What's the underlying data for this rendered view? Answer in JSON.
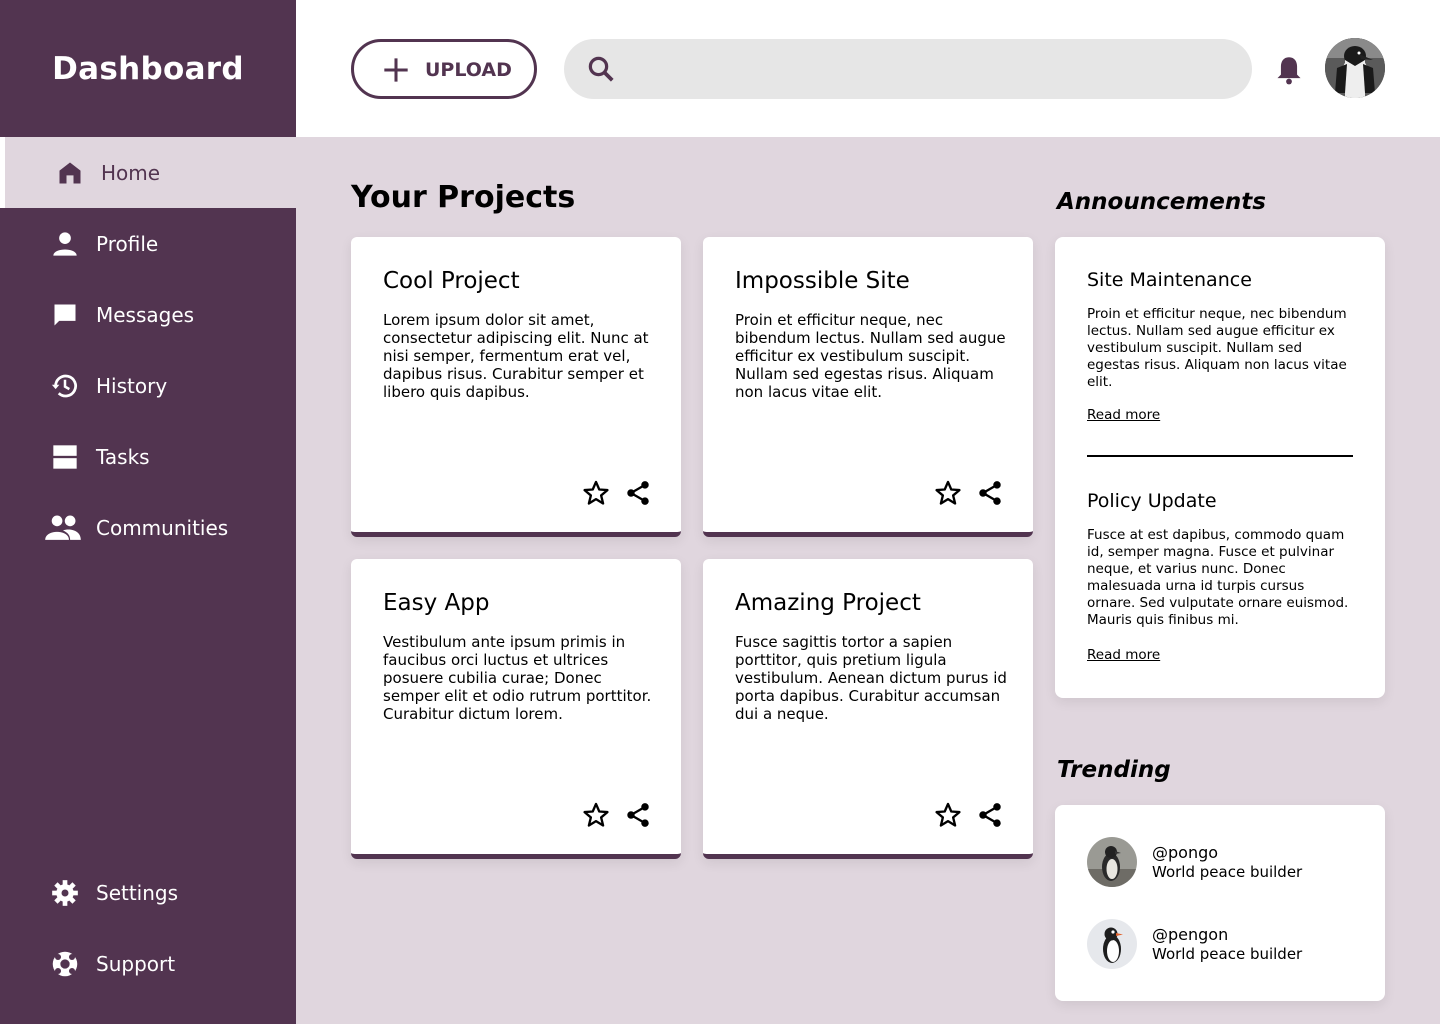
{
  "brand": {
    "title": "Dashboard"
  },
  "sidebar": {
    "items": [
      {
        "label": "Home",
        "icon": "home-icon",
        "active": true
      },
      {
        "label": "Profile",
        "icon": "person-icon"
      },
      {
        "label": "Messages",
        "icon": "message-icon"
      },
      {
        "label": "History",
        "icon": "history-icon"
      },
      {
        "label": "Tasks",
        "icon": "tasks-icon"
      },
      {
        "label": "Communities",
        "icon": "people-icon"
      }
    ],
    "bottom_items": [
      {
        "label": "Settings",
        "icon": "gear-icon"
      },
      {
        "label": "Support",
        "icon": "lifebuoy-icon"
      }
    ]
  },
  "header": {
    "upload_label": "UPLOAD",
    "search_placeholder": "",
    "search_value": ""
  },
  "projects": {
    "title": "Your Projects",
    "cards": [
      {
        "title": "Cool Project",
        "body": "Lorem ipsum dolor sit amet, consectetur adipiscing elit. Nunc at nisi semper, fermentum erat vel, dapibus risus. Curabitur semper et libero quis dapibus."
      },
      {
        "title": "Impossible Site",
        "body": "Proin et efficitur neque, nec bibendum lectus. Nullam sed augue efficitur ex vestibulum suscipit. Nullam sed egestas risus. Aliquam non lacus vitae elit."
      },
      {
        "title": "Easy App",
        "body": "Vestibulum ante ipsum primis in faucibus orci luctus et ultrices posuere cubilia curae; Donec semper elit et odio rutrum porttitor. Curabitur dictum lorem."
      },
      {
        "title": "Amazing Project",
        "body": "Fusce sagittis tortor a sapien porttitor, quis pretium ligula vestibulum. Aenean dictum purus id porta dapibus. Curabitur accumsan dui a neque."
      }
    ]
  },
  "announcements": {
    "heading": "Announcements",
    "items": [
      {
        "title": "Site Maintenance",
        "body": "Proin et efficitur neque, nec bibendum lectus. Nullam sed augue efficitur ex vestibulum suscipit. Nullam sed egestas risus. Aliquam non lacus vitae elit.",
        "link": "Read more"
      },
      {
        "title": "Policy Update",
        "body": "Fusce at est dapibus, commodo quam id, semper magna. Fusce et pulvinar neque, et varius nunc. Donec malesuada urna id turpis cursus ornare. Sed vulputate ornare euismod. Mauris quis finibus mi.",
        "link": "Read more"
      }
    ]
  },
  "trending": {
    "heading": "Trending",
    "users": [
      {
        "handle": "@pongo",
        "desc": "World peace builder"
      },
      {
        "handle": "@pengon",
        "desc": "World peace builder"
      }
    ]
  },
  "colors": {
    "accent": "#523450",
    "background": "#e0d6de",
    "search_bg": "#e6e6e6"
  }
}
